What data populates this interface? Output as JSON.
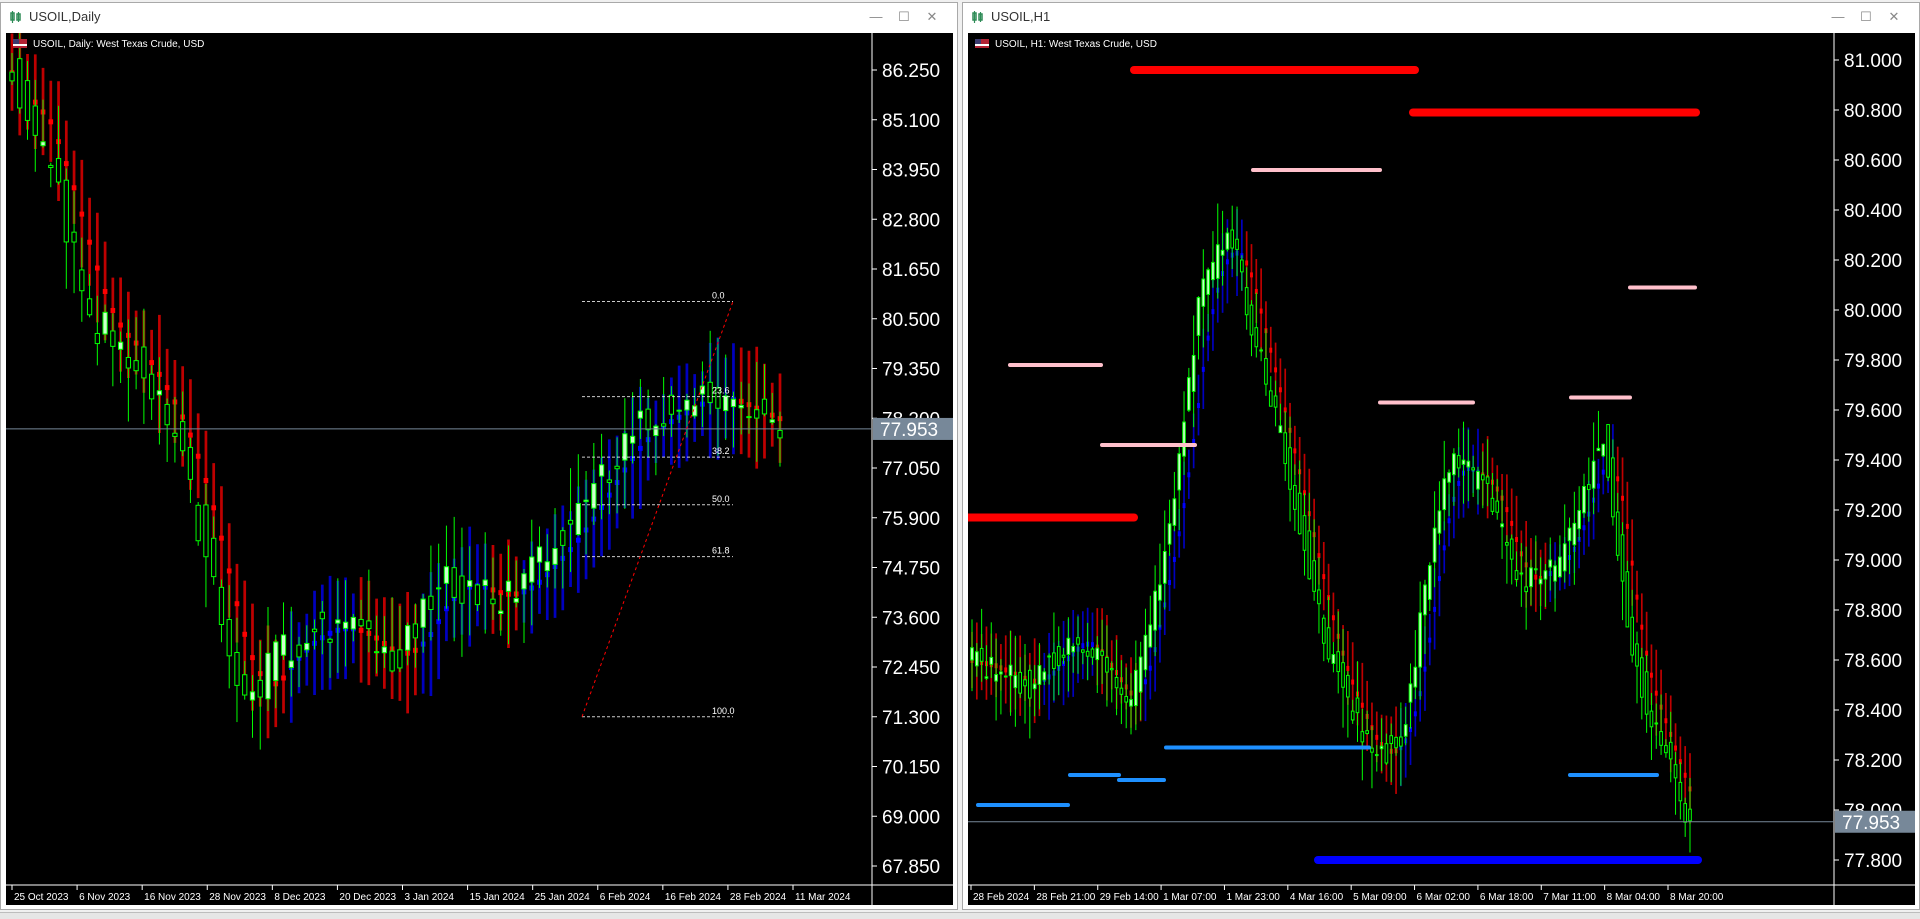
{
  "windows": [
    {
      "title": "USOIL,Daily",
      "legend": "USOIL, Daily:  West Texas Crude, USD",
      "price_ticks": [
        "86.250",
        "85.100",
        "83.950",
        "82.800",
        "81.650",
        "80.500",
        "79.350",
        "78.200",
        "77.050",
        "75.900",
        "74.750",
        "73.600",
        "72.450",
        "71.300",
        "70.150",
        "69.000",
        "67.850"
      ],
      "price_min": 67.85,
      "price_max": 86.25,
      "current_price": "77.953",
      "current_value": 77.953,
      "time_ticks": [
        "25 Oct 2023",
        "6 Nov 2023",
        "16 Nov 2023",
        "28 Nov 2023",
        "8 Dec 2023",
        "20 Dec 2023",
        "3 Jan 2024",
        "15 Jan 2024",
        "25 Jan 2024",
        "6 Feb 2024",
        "16 Feb 2024",
        "28 Feb 2024",
        "11 Mar 2024"
      ],
      "fib_levels": [
        {
          "label": "0.0",
          "price": 80.9
        },
        {
          "label": "23.6",
          "price": 78.7
        },
        {
          "label": "38.2",
          "price": 77.3
        },
        {
          "label": "50.0",
          "price": 76.2
        },
        {
          "label": "61.8",
          "price": 75.0
        },
        {
          "label": "100.0",
          "price": 71.3
        }
      ]
    },
    {
      "title": "USOIL,H1",
      "legend": "USOIL, H1:  West Texas Crude, USD",
      "price_ticks": [
        "81.000",
        "80.800",
        "80.600",
        "80.400",
        "80.200",
        "80.000",
        "79.800",
        "79.600",
        "79.400",
        "79.200",
        "79.000",
        "78.800",
        "78.600",
        "78.400",
        "78.200",
        "78.000",
        "77.800"
      ],
      "price_min": 77.8,
      "price_max": 81.0,
      "current_price": "77.953",
      "current_value": 77.953,
      "time_ticks": [
        "28 Feb 2024",
        "28 Feb 21:00",
        "29 Feb 14:00",
        "1 Mar 07:00",
        "1 Mar 23:00",
        "4 Mar 16:00",
        "5 Mar 09:00",
        "6 Mar 02:00",
        "6 Mar 18:00",
        "7 Mar 11:00",
        "8 Mar 04:00",
        "8 Mar 20:00"
      ]
    }
  ],
  "colors": {
    "bull": "#00ff00",
    "bull_body": "#ccffcc",
    "bear": "#ff0000",
    "ma_up": "#0000ff",
    "ma_down": "#ff0000",
    "support": "#1e90ff",
    "resistance": "#ffc0cb",
    "current_line": "#778899",
    "current_label_bg": "#778899"
  }
}
